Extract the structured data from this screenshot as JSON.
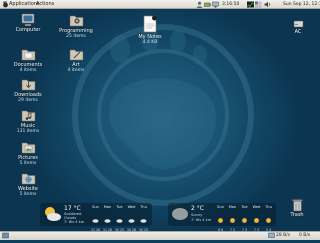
{
  "top_panel": {
    "menus": [
      "Applications",
      "Actions"
    ],
    "clock_time": "3:16:50",
    "date": "Sun Sep 12, 12:18"
  },
  "desktop_icons": [
    {
      "name": "Computer",
      "sub": ""
    },
    {
      "name": "Programming",
      "sub": "25 items"
    },
    {
      "name": "My Notes",
      "sub": "4.4 KB"
    },
    {
      "name": "AC",
      "sub": ""
    },
    {
      "name": "Documents",
      "sub": "4 items"
    },
    {
      "name": "Art",
      "sub": "4 items"
    },
    {
      "name": "Downloads",
      "sub": "29 items"
    },
    {
      "name": "Music",
      "sub": "131 items"
    },
    {
      "name": "Pictures",
      "sub": "5 items"
    },
    {
      "name": "Website",
      "sub": "5 items"
    },
    {
      "name": "Trash",
      "sub": ""
    }
  ],
  "weather_left": {
    "temp": "17 °C",
    "cond": [
      "Scattered",
      "Clouds",
      "7: Ws 4 km"
    ],
    "forecast": [
      {
        "day": "Sun",
        "temp": "31 26"
      },
      {
        "day": "Mon",
        "temp": "31 26"
      },
      {
        "day": "Tue",
        "temp": "30 25"
      },
      {
        "day": "Wed",
        "temp": "30 26"
      },
      {
        "day": "Thu",
        "temp": "30 25"
      }
    ]
  },
  "weather_right": {
    "temp": "2 °C",
    "cond": [
      "Sunny",
      "7: Ws 4 km"
    ],
    "forecast": [
      {
        "day": "Sun",
        "temp": "6 6"
      },
      {
        "day": "Mon",
        "temp": "7 2"
      },
      {
        "day": "Tue",
        "temp": "7 3"
      },
      {
        "day": "Wed",
        "temp": "7 3"
      },
      {
        "day": "Thu",
        "temp": "5 4"
      }
    ]
  },
  "bottom_panel": {
    "download_rate": "28 B/s",
    "upload_rate": "0 B/s"
  },
  "colors": {
    "desktop": "#114563",
    "folder": "#c8c2b0",
    "panel": "#e3e0d9"
  }
}
